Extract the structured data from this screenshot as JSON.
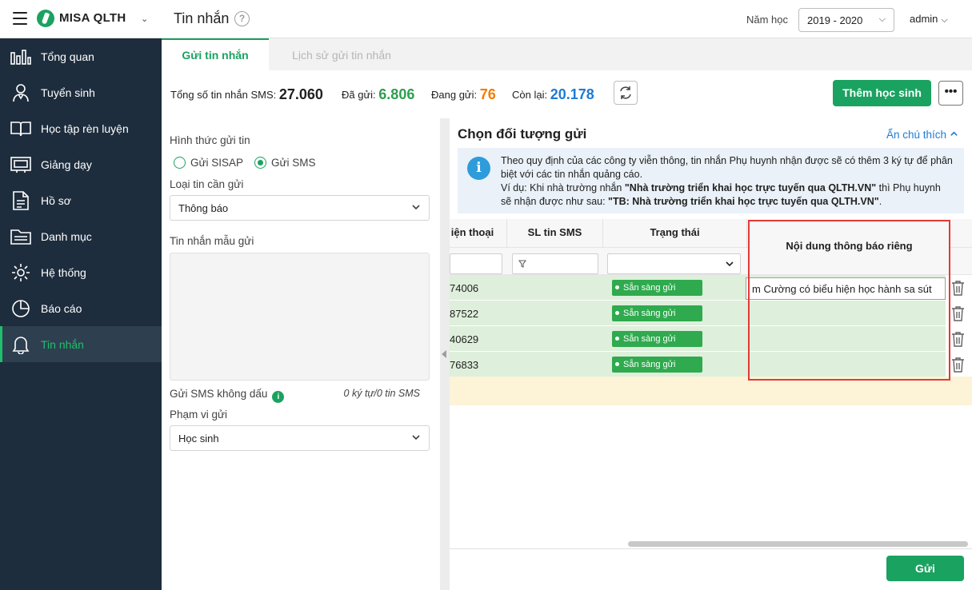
{
  "app": {
    "brand": "MISA QLTH",
    "page_title": "Tin nhắn"
  },
  "header": {
    "year_label": "Năm học",
    "year_value": "2019 - 2020",
    "user": "admin"
  },
  "sidebar": {
    "items": [
      {
        "label": "Tổng quan",
        "icon": "bar-chart-icon"
      },
      {
        "label": "Tuyển sinh",
        "icon": "student-icon"
      },
      {
        "label": "Học tập rèn luyện",
        "icon": "book-icon"
      },
      {
        "label": "Giảng dạy",
        "icon": "board-icon"
      },
      {
        "label": "Hồ sơ",
        "icon": "document-icon"
      },
      {
        "label": "Danh mục",
        "icon": "folder-icon"
      },
      {
        "label": "Hệ thống",
        "icon": "gear-icon"
      },
      {
        "label": "Báo cáo",
        "icon": "pie-chart-icon"
      },
      {
        "label": "Tin nhắn",
        "icon": "bell-icon",
        "active": true
      }
    ]
  },
  "tabs": [
    {
      "label": "Gửi tin nhắn",
      "active": true
    },
    {
      "label": "Lịch sử gửi tin nhắn",
      "active": false
    }
  ],
  "stats": {
    "total_label": "Tổng số tin nhắn SMS:",
    "total_value": "27.060",
    "sent_label": "Đã gửi:",
    "sent_value": "6.806",
    "sending_label": "Đang gửi:",
    "sending_value": "76",
    "remaining_label": "Còn lại:",
    "remaining_value": "20.178"
  },
  "toolbar": {
    "add_student": "Thêm học sinh",
    "more": "•••"
  },
  "form": {
    "send_method_label": "Hình thức gửi tin",
    "radio_sisap": "Gửi SISAP",
    "radio_sms": "Gửi SMS",
    "message_type_label": "Loại tin cần gửi",
    "message_type_value": "Thông báo",
    "template_label": "Tin nhắn mẫu gửi",
    "unsigned_label": "Gửi SMS không dấu",
    "counter": "0 ký tự/0 tin SMS",
    "scope_label": "Phạm vi gửi",
    "scope_value": "Học sinh"
  },
  "recipients": {
    "title": "Chọn đối tượng gửi",
    "hide_note": "Ẩn chú thích",
    "notice_line1": "Theo quy định của các công ty viễn thông, tin nhắn Phụ huynh nhận được sẽ có thêm 3 ký tự để phân biệt với các tin nhắn quảng cáo.",
    "notice_line2_pre": "Ví dụ: Khi nhà trường nhắn ",
    "notice_line2_quote": "\"Nhà trường triển khai học trực tuyến qua QLTH.VN\"",
    "notice_line2_mid": " thì Phụ huynh sẽ nhận được như sau: ",
    "notice_line2_quote2": "\"TB: Nhà trường triển khai học trực tuyến qua QLTH.VN\"",
    "notice_line2_end": "."
  },
  "table": {
    "columns": {
      "phone": "iện thoại",
      "sms_count": "SL tin SMS",
      "status": "Trạng thái",
      "content": "Nội dung thông báo riêng"
    },
    "rows": [
      {
        "phone": "74006",
        "status": "Sẵn sàng gửi",
        "content": "m Cường có biểu hiện học hành sa sút"
      },
      {
        "phone": "87522",
        "status": "Sẵn sàng gửi"
      },
      {
        "phone": "40629",
        "status": "Sẵn sàng gửi"
      },
      {
        "phone": "76833",
        "status": "Sẵn sàng gửi"
      }
    ]
  },
  "footer": {
    "send": "Gửi"
  },
  "colors": {
    "brand_green": "#1aa260",
    "sidebar_bg": "#1e2d3d",
    "link_blue": "#1e7bd6",
    "sending_orange": "#f57c00",
    "remaining_blue": "#1e7bd6",
    "highlight_red": "#e53935"
  }
}
